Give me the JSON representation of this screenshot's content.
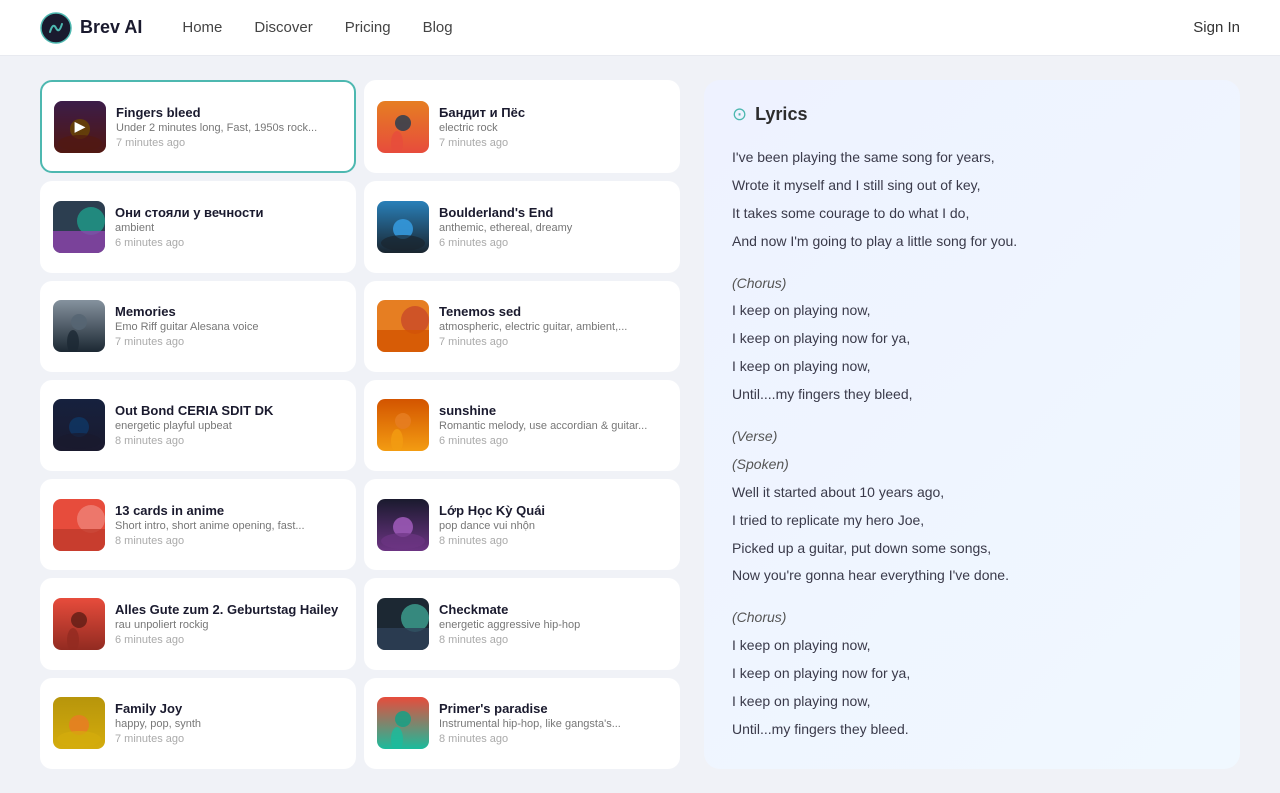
{
  "navbar": {
    "logo_text": "Brev AI",
    "links": [
      "Home",
      "Discover",
      "Pricing",
      "Blog"
    ],
    "sign_in": "Sign In"
  },
  "songs": [
    {
      "id": 1,
      "title": "Fingers bleed",
      "desc": "Under 2 minutes long, Fast, 1950s rock...",
      "time": "7 minutes ago",
      "active": true,
      "color1": "#c0392b",
      "color2": "#8e44ad",
      "color3": "#f39c12"
    },
    {
      "id": 2,
      "title": "Бандит и Пёс",
      "desc": "electric rock",
      "time": "7 minutes ago",
      "active": false,
      "color1": "#e74c3c",
      "color2": "#2c3e50",
      "color3": "#e67e22"
    },
    {
      "id": 3,
      "title": "Они стояли у вечности",
      "desc": "ambient",
      "time": "6 minutes ago",
      "active": false,
      "color1": "#2c3e50",
      "color2": "#8e44ad",
      "color3": "#1abc9c"
    },
    {
      "id": 4,
      "title": "Boulderland's End",
      "desc": "anthemic, ethereal, dreamy",
      "time": "6 minutes ago",
      "active": false,
      "color1": "#1a252f",
      "color2": "#2980b9",
      "color3": "#3498db"
    },
    {
      "id": 5,
      "title": "Memories",
      "desc": "Emo Riff guitar Alesana voice",
      "time": "7 minutes ago",
      "active": false,
      "color1": "#1c2833",
      "color2": "#566573",
      "color3": "#85929e"
    },
    {
      "id": 6,
      "title": "Tenemos sed",
      "desc": "atmospheric, electric guitar, ambient,...",
      "time": "7 minutes ago",
      "active": false,
      "color1": "#e67e22",
      "color2": "#d35400",
      "color3": "#c0392b"
    },
    {
      "id": 7,
      "title": "Out Bond CERIA SDIT DK",
      "desc": "energetic playful upbeat",
      "time": "8 minutes ago",
      "active": false,
      "color1": "#1a1a2e",
      "color2": "#16213e",
      "color3": "#0f3460"
    },
    {
      "id": 8,
      "title": "sunshine",
      "desc": "Romantic melody, use accordian & guitar...",
      "time": "6 minutes ago",
      "active": false,
      "color1": "#f39c12",
      "color2": "#e67e22",
      "color3": "#d35400"
    },
    {
      "id": 9,
      "title": "13 cards in anime",
      "desc": "Short intro, short anime opening, fast...",
      "time": "8 minutes ago",
      "active": false,
      "color1": "#e74c3c",
      "color2": "#c0392b",
      "color3": "#f1948a"
    },
    {
      "id": 10,
      "title": "Lớp Học Kỳ Quái",
      "desc": "pop dance vui nhộn",
      "time": "8 minutes ago",
      "active": false,
      "color1": "#6c3483",
      "color2": "#1a1a2e",
      "color3": "#9b59b6"
    },
    {
      "id": 11,
      "title": "Alles Gute zum 2. Geburtstag Hailey",
      "desc": "rau unpoliert rockig",
      "time": "6 minutes ago",
      "active": false,
      "color1": "#922b21",
      "color2": "#641e16",
      "color3": "#e74c3c"
    },
    {
      "id": 12,
      "title": "Checkmate",
      "desc": "energetic aggressive hip-hop",
      "time": "8 minutes ago",
      "active": false,
      "color1": "#1c2833",
      "color2": "#2e4057",
      "color3": "#48c9b0"
    },
    {
      "id": 13,
      "title": "Family Joy",
      "desc": "happy, pop, synth",
      "time": "7 minutes ago",
      "active": false,
      "color1": "#d4ac0d",
      "color2": "#b7950b",
      "color3": "#e67e22"
    },
    {
      "id": 14,
      "title": "Primer's paradise",
      "desc": "Instrumental hip-hop, like gangsta's...",
      "time": "8 minutes ago",
      "active": false,
      "color1": "#1abc9c",
      "color2": "#16a085",
      "color3": "#e74c3c"
    }
  ],
  "lyrics_panel": {
    "title": "Lyrics",
    "content": [
      {
        "type": "line",
        "text": "I've been playing the same song for years,"
      },
      {
        "type": "line",
        "text": "Wrote it myself and I still sing out of key,"
      },
      {
        "type": "line",
        "text": "It takes some courage to do what I do,"
      },
      {
        "type": "line",
        "text": "And now I'm going to play a little song for you."
      },
      {
        "type": "blank"
      },
      {
        "type": "label",
        "text": "(Chorus)"
      },
      {
        "type": "line",
        "text": "I keep on playing now,"
      },
      {
        "type": "line",
        "text": "I keep on playing now for ya,"
      },
      {
        "type": "line",
        "text": "I keep on playing now,"
      },
      {
        "type": "line",
        "text": "Until....my fingers they bleed,"
      },
      {
        "type": "blank"
      },
      {
        "type": "label",
        "text": "(Verse)"
      },
      {
        "type": "label",
        "text": "(Spoken)"
      },
      {
        "type": "line",
        "text": "Well it started about 10 years ago,"
      },
      {
        "type": "line",
        "text": "I tried to replicate my hero Joe,"
      },
      {
        "type": "line",
        "text": "Picked up a guitar, put down some songs,"
      },
      {
        "type": "line",
        "text": "Now you're gonna hear everything I've done."
      },
      {
        "type": "blank"
      },
      {
        "type": "label",
        "text": "(Chorus)"
      },
      {
        "type": "line",
        "text": "I keep on playing now,"
      },
      {
        "type": "line",
        "text": "I keep on playing now for ya,"
      },
      {
        "type": "line",
        "text": "I keep on playing now,"
      },
      {
        "type": "line",
        "text": "Until...my fingers they bleed."
      }
    ]
  }
}
